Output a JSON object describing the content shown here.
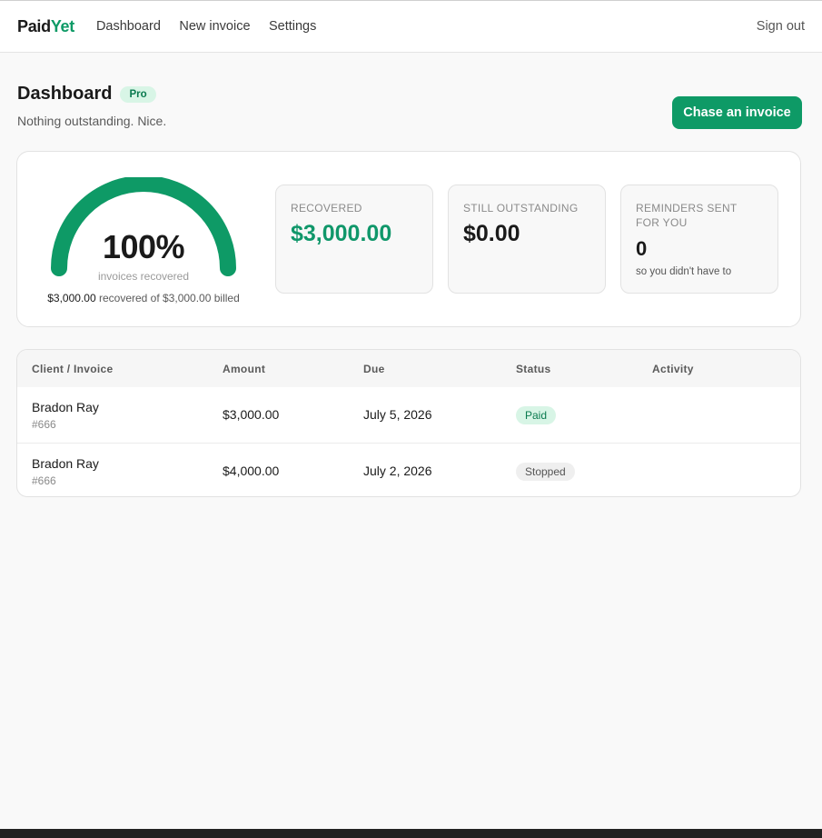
{
  "app": {
    "logo_part1": "Paid",
    "logo_part2": "Yet",
    "nav": [
      "Dashboard",
      "New invoice",
      "Settings"
    ],
    "sign_out": "Sign out"
  },
  "page": {
    "title": "Dashboard",
    "plan_badge": "Pro",
    "subtitle": "Nothing outstanding. Nice.",
    "primary_action": "Chase an invoice"
  },
  "gauge": {
    "value": "100%",
    "fraction": 1.0,
    "label": "invoices recovered",
    "recovered_amount": "$3,000.00",
    "summary_text": "recovered of $3,000.00 billed",
    "color": "#0e9a66"
  },
  "metrics": [
    {
      "label": "Recovered",
      "value": "$3,000.00"
    },
    {
      "label": "Still outstanding",
      "value": "$0.00"
    },
    {
      "label": "Reminders sent for you",
      "value": "0",
      "note": "so you didn't have to"
    }
  ],
  "table": {
    "headers": [
      "Client / Invoice",
      "Amount",
      "Due",
      "Status",
      "Activity"
    ],
    "rows": [
      {
        "client": "Bradon Ray",
        "invoice": "#666",
        "amount": "$3,000.00",
        "due": "July 5, 2026",
        "status": "Paid"
      },
      {
        "client": "Bradon Ray",
        "invoice": "#666",
        "amount": "$4,000.00",
        "due": "July 2, 2026",
        "status": "Stopped"
      }
    ]
  },
  "colors": {
    "brand": "#0e9a66",
    "paid_badge": "#d8f5e6",
    "stopped_badge": "#efefef"
  }
}
